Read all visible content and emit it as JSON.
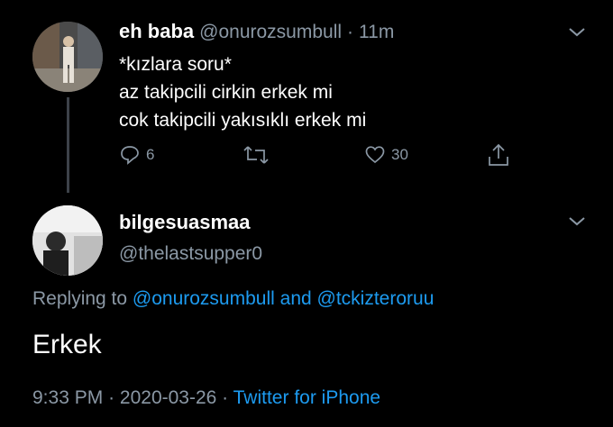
{
  "colors": {
    "background": "#000000",
    "primary_text": "#ffffff",
    "secondary_text": "#8b98a5",
    "link": "#1d9bf0",
    "thread_line": "#3d4249"
  },
  "parent_tweet": {
    "display_name": "eh baba",
    "handle": "@onurozsumbull",
    "separator": "·",
    "time": "11m",
    "lines": [
      "*kızlara soru*",
      "az takipcili cirkin erkek mi",
      "cok takipcili yakısıklı erkek mi"
    ],
    "actions": {
      "reply_icon": "reply-icon",
      "reply_count": "6",
      "retweet_icon": "retweet-icon",
      "like_icon": "like-icon",
      "like_count": "30",
      "share_icon": "share-icon"
    },
    "menu_icon": "chevron-down-icon"
  },
  "reply_tweet": {
    "display_name": "bilgesuasmaa",
    "handle": "@thelastsupper0",
    "menu_icon": "chevron-down-icon",
    "replying_to_prefix": "Replying to",
    "replying_to_user1": "@onurozsumbull",
    "replying_to_and": "and",
    "replying_to_user2": "@tckizteroruu",
    "text": "Erkek",
    "timestamp_time": "9:33 PM",
    "timestamp_sep1": "·",
    "timestamp_date": "2020-03-26",
    "timestamp_sep2": "·",
    "source": "Twitter for iPhone"
  }
}
